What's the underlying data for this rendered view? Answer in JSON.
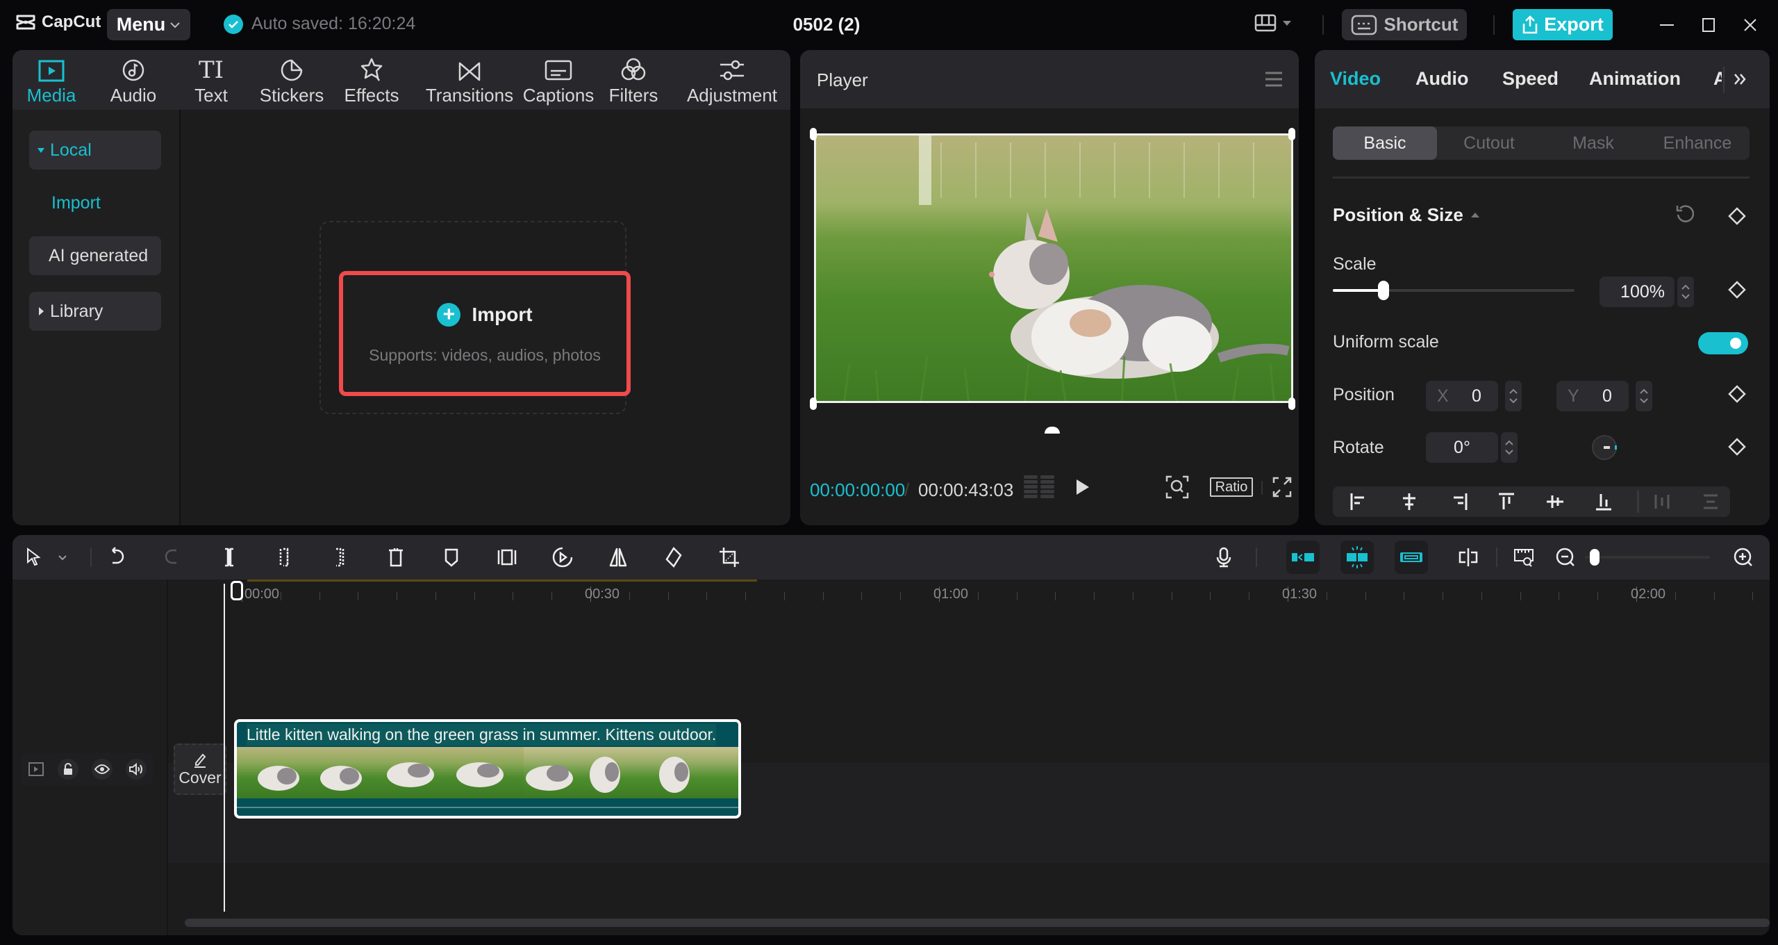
{
  "app": {
    "name": "CapCut",
    "menu_label": "Menu",
    "autosave": "Auto saved: 16:20:24",
    "project_title": "0502 (2)",
    "shortcut_label": "Shortcut",
    "export_label": "Export",
    "accent_color": "#19c0cf",
    "highlight_color": "#f04a4a"
  },
  "media_panel": {
    "tabs": [
      {
        "label": "Media",
        "icon": "media-icon",
        "active": true
      },
      {
        "label": "Audio",
        "icon": "audio-icon"
      },
      {
        "label": "Text",
        "icon": "text-icon"
      },
      {
        "label": "Stickers",
        "icon": "sticker-icon"
      },
      {
        "label": "Effects",
        "icon": "effects-icon"
      },
      {
        "label": "Transitions",
        "icon": "transitions-icon"
      },
      {
        "label": "Captions",
        "icon": "captions-icon"
      },
      {
        "label": "Filters",
        "icon": "filters-icon"
      },
      {
        "label": "Adjustment",
        "icon": "adjustment-icon"
      }
    ],
    "sidebar": [
      {
        "label": "Local",
        "expanded": true
      },
      {
        "label": "Import"
      },
      {
        "label": "AI generated"
      },
      {
        "label": "Library",
        "expanded": false
      }
    ],
    "import_card": {
      "title": "Import",
      "subtitle": "Supports: videos, audios, photos"
    }
  },
  "player": {
    "title": "Player",
    "current_time": "00:00:00:00",
    "separator": "/",
    "total_time": "00:00:43:03",
    "ratio_label": "Ratio"
  },
  "properties": {
    "tabs": [
      "Video",
      "Audio",
      "Speed",
      "Animation",
      "A"
    ],
    "active_tab": "Video",
    "subtabs": [
      "Basic",
      "Cutout",
      "Mask",
      "Enhance"
    ],
    "active_subtab": "Basic",
    "section_title": "Position & Size",
    "scale": {
      "label": "Scale",
      "value": "100%",
      "slider_fraction": 0.21
    },
    "uniform_scale": {
      "label": "Uniform scale",
      "on": true
    },
    "position": {
      "label": "Position",
      "x_label": "X",
      "x": "0",
      "y_label": "Y",
      "y": "0"
    },
    "rotate": {
      "label": "Rotate",
      "value": "0°"
    }
  },
  "timeline": {
    "ruler_labels": [
      "00:00",
      "00:30",
      "01:00",
      "01:30",
      "02:00"
    ],
    "clip_title": "Little kitten walking on the green grass in summer. Kittens outdoor.",
    "cover_label": "Cover",
    "zoom_fraction": 0.04
  }
}
